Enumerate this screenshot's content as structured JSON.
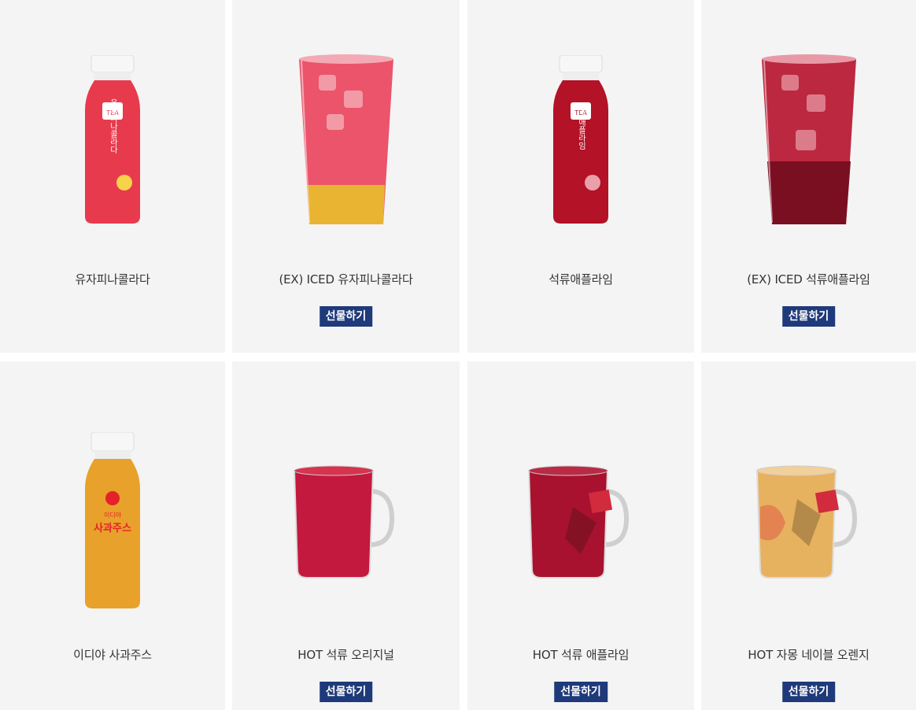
{
  "products": [
    {
      "name": "유자피나콜라다",
      "gift": "",
      "bottle_label": "유자피나콜라다",
      "type": "bottle",
      "color": "#e83a4d"
    },
    {
      "name": "(EX) ICED 유자피나콜라다",
      "gift": "선물하기",
      "type": "iced-glass",
      "color": "#e9455d"
    },
    {
      "name": "석류애플라임",
      "gift": "",
      "bottle_label": "석류애플라임",
      "type": "bottle",
      "color": "#b31227"
    },
    {
      "name": "(EX) ICED 석류애플라임",
      "gift": "선물하기",
      "type": "iced-glass",
      "color": "#b81c35"
    },
    {
      "name": "이디야 사과주스",
      "gift": "",
      "bottle_label": "사과주스",
      "type": "bottle",
      "color": "#e8a12a"
    },
    {
      "name": "HOT 석류 오리지널",
      "gift": "선물하기",
      "type": "mug",
      "color": "#c4193e"
    },
    {
      "name": "HOT 석류 애플라임",
      "gift": "선물하기",
      "type": "mug",
      "color": "#a8122e"
    },
    {
      "name": "HOT 자몽 네이블 오렌지",
      "gift": "선물하기",
      "type": "mug",
      "color": "#e7b25f"
    }
  ],
  "bottle_brand": "TEA",
  "juice_brand": "이디야"
}
